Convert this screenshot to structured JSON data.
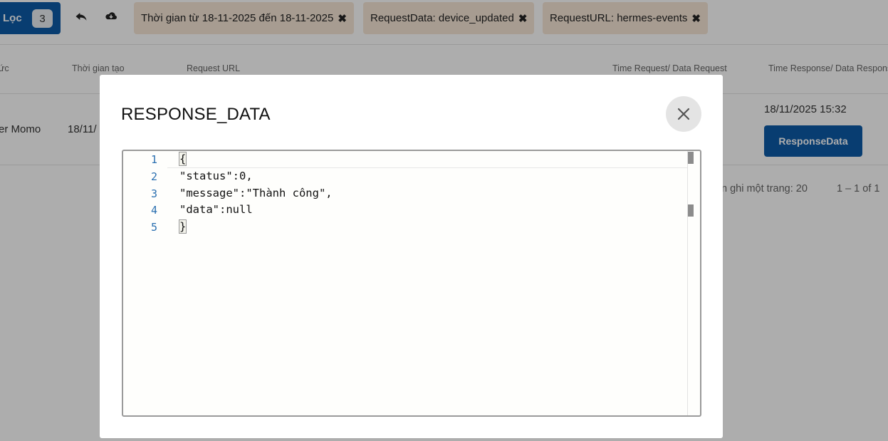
{
  "toolbar": {
    "filter_label": "Lọc",
    "filter_count": "3",
    "undo_icon": "undo-arrow-icon",
    "download_icon": "cloud-download-icon",
    "chips": [
      {
        "label": "Thời gian từ 18-11-2025 đến 18-11-2025",
        "remove": "✖"
      },
      {
        "label": "RequestData: device_updated",
        "remove": "✖"
      },
      {
        "label": "RequestURL: hermes-events",
        "remove": "✖"
      }
    ]
  },
  "table": {
    "headers": [
      "ức",
      "Thời gian tạo",
      "Request URL",
      "Time Request/ Data Request",
      "Time Response/ Data Respons"
    ],
    "row": {
      "partner": "er Momo",
      "created": "18/11/",
      "response_time": "18/11/2025 15:32",
      "response_button": "ResponseData"
    }
  },
  "pagination": {
    "per_page": "n ghi một trang: 20",
    "range": "1 – 1 of 1"
  },
  "modal": {
    "title": "RESPONSE_DATA",
    "close_icon": "close-icon",
    "line_numbers": [
      "1",
      "2",
      "3",
      "4",
      "5"
    ],
    "code_lines": [
      "{",
      "\"status\":0,",
      "\"message\":\"Thành công\",",
      "\"data\":null",
      "}"
    ]
  }
}
